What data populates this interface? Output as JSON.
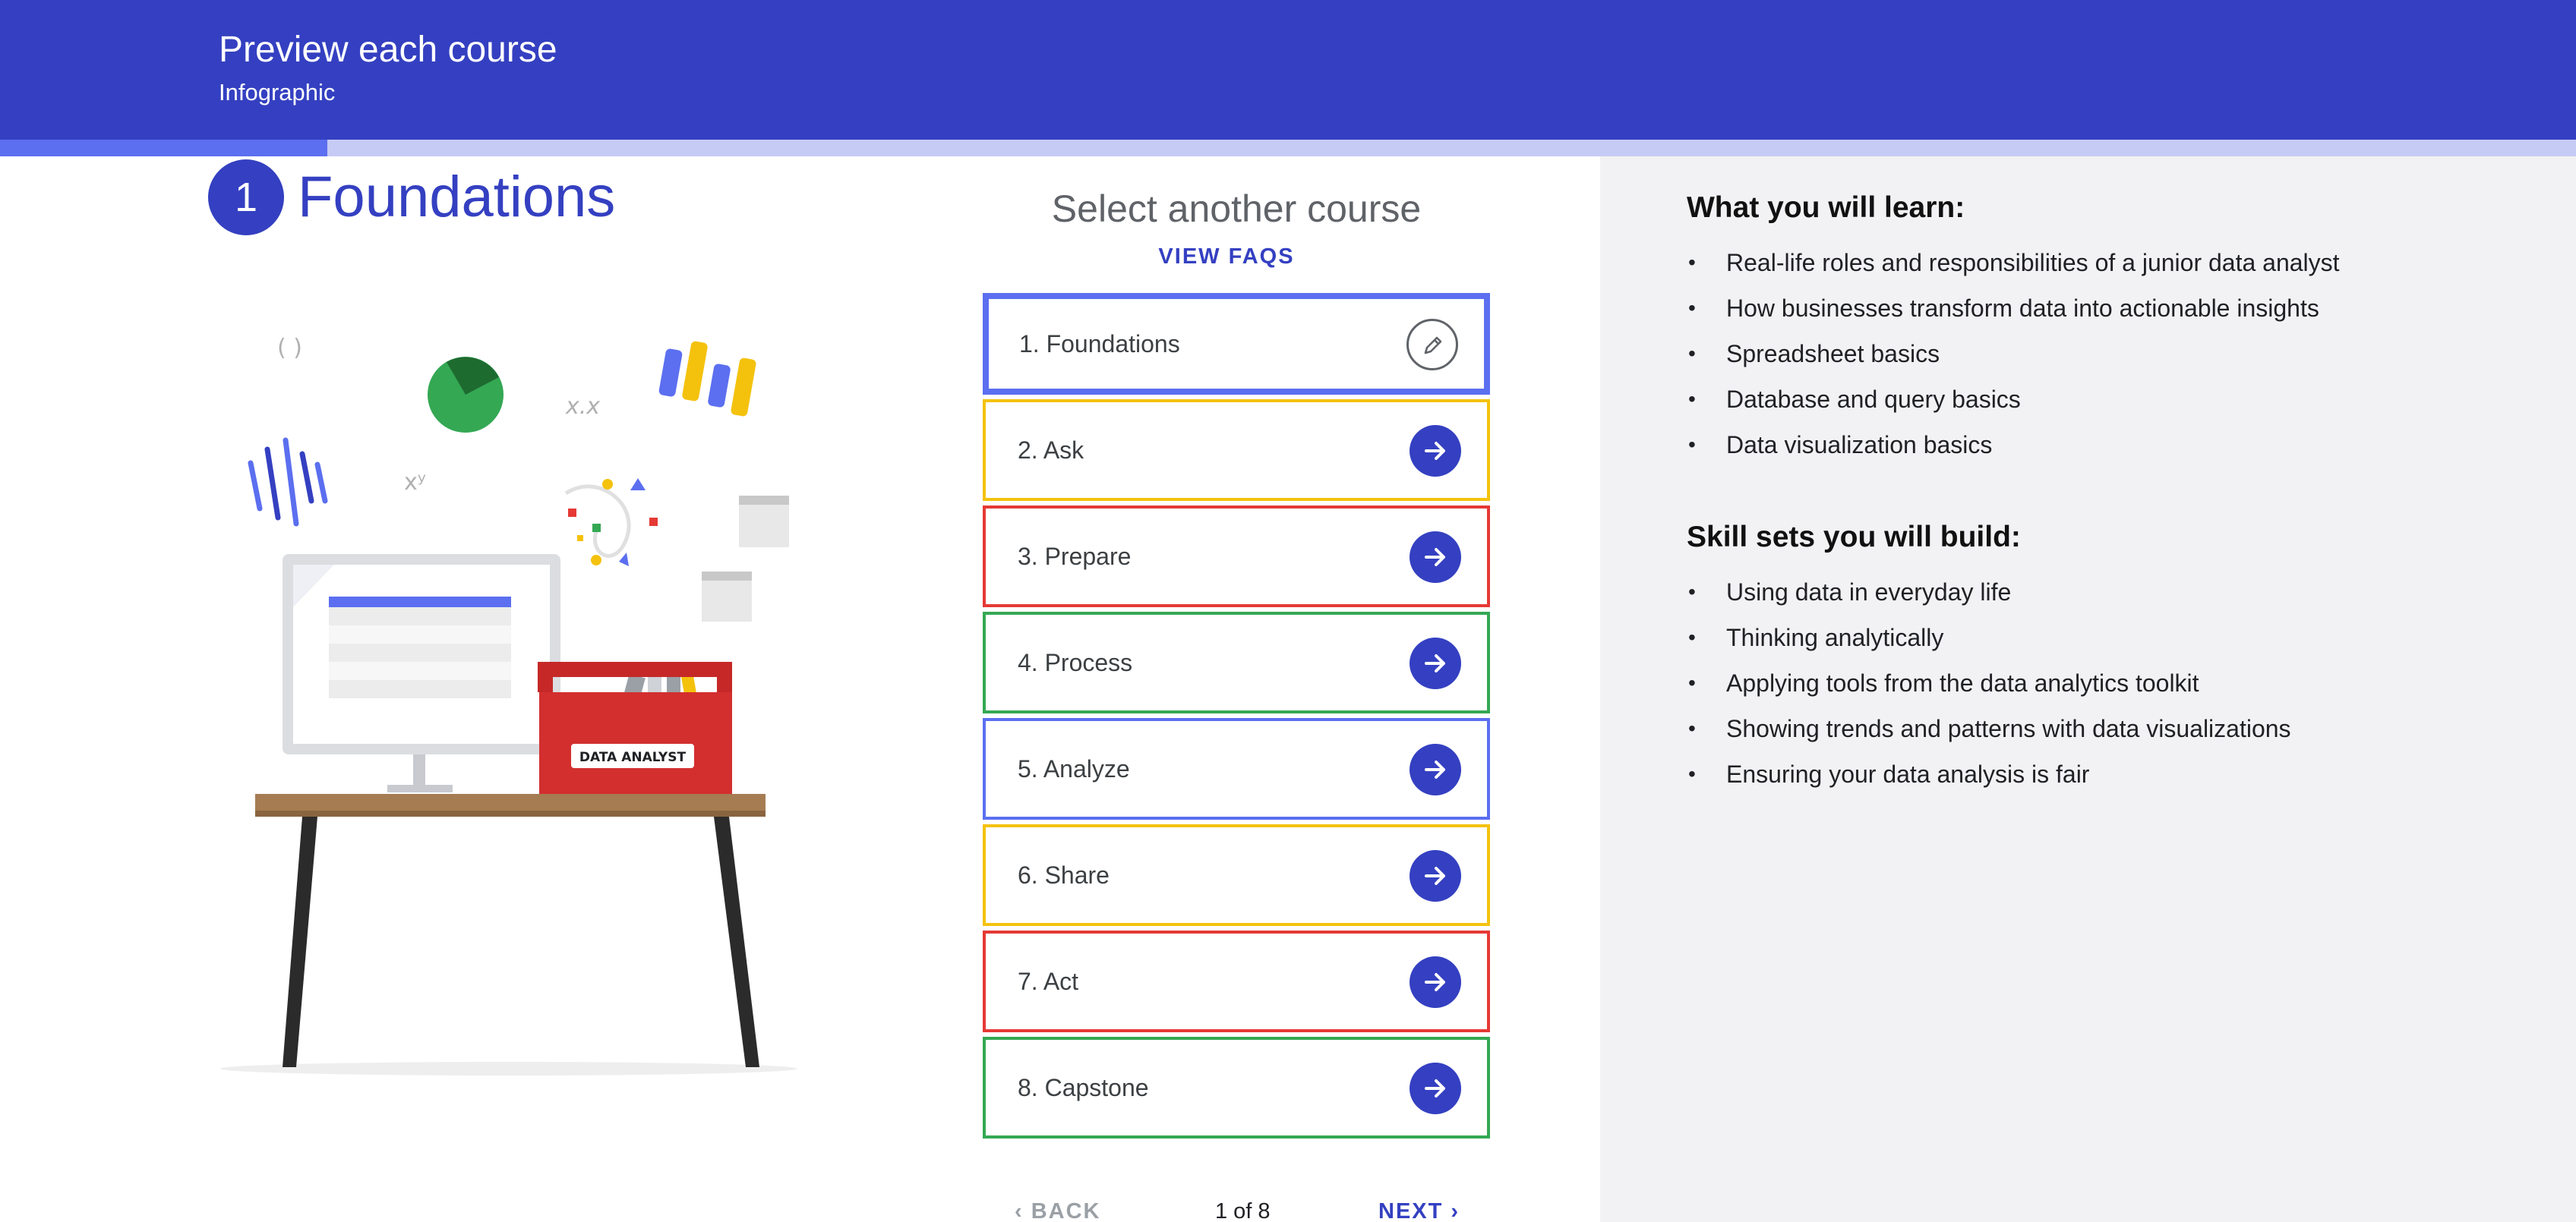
{
  "header": {
    "title": "Preview each course",
    "subtitle": "Infographic"
  },
  "progress": {
    "fraction": 0.127
  },
  "course": {
    "number": "1",
    "title": "Foundations"
  },
  "illustration": {
    "toolbox_label": "DATA ANALYST",
    "symbol_parens": "( )",
    "symbol_xx": "x.x",
    "symbol_xy": "xʸ"
  },
  "selector": {
    "heading": "Select another course",
    "faq_label": "VIEW FAQS",
    "items": [
      {
        "label": "1. Foundations",
        "color": "#5b6ff0",
        "active": true,
        "icon": "pencil-icon"
      },
      {
        "label": "2. Ask",
        "color": "#f4c20d",
        "active": false,
        "icon": "arrow-right-icon"
      },
      {
        "label": "3. Prepare",
        "color": "#e53935",
        "active": false,
        "icon": "arrow-right-icon"
      },
      {
        "label": "4. Process",
        "color": "#34a853",
        "active": false,
        "icon": "arrow-right-icon"
      },
      {
        "label": "5. Analyze",
        "color": "#5b6ff0",
        "active": false,
        "icon": "arrow-right-icon"
      },
      {
        "label": "6. Share",
        "color": "#f4c20d",
        "active": false,
        "icon": "arrow-right-icon"
      },
      {
        "label": "7. Act",
        "color": "#e53935",
        "active": false,
        "icon": "arrow-right-icon"
      },
      {
        "label": "8. Capstone",
        "color": "#34a853",
        "active": false,
        "icon": "arrow-right-icon"
      }
    ]
  },
  "pager": {
    "back": "BACK",
    "count": "1 of 8",
    "next": "NEXT"
  },
  "learn": {
    "heading": "What you will learn:",
    "items": [
      "Real-life roles and responsibilities of a junior data analyst",
      "How businesses transform data into actionable insights",
      "Spreadsheet basics",
      "Database and query basics",
      "Data visualization basics"
    ]
  },
  "skills": {
    "heading": "Skill sets you will build:",
    "items": [
      "Using data in everyday life",
      "Thinking analytically",
      "Applying tools from the data analytics toolkit",
      "Showing trends and patterns with data visualizations",
      "Ensuring your data analysis is fair"
    ]
  },
  "colors": {
    "brand": "#3440c1",
    "accent": "#5b6ff0",
    "panel": "#f2f2f4"
  }
}
